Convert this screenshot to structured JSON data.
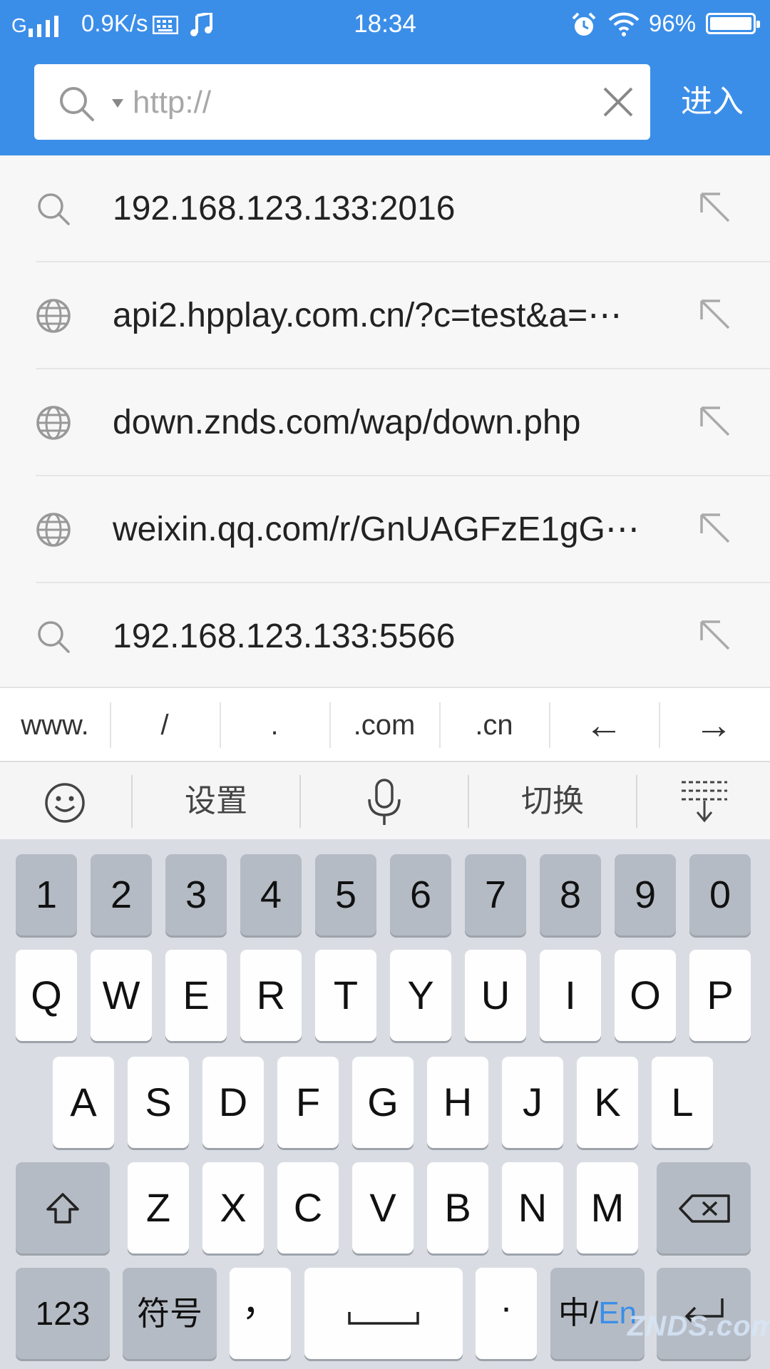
{
  "status_bar": {
    "carrier": "G",
    "net_speed": "0.9K/s",
    "time": "18:34",
    "battery": "96%"
  },
  "address_bar": {
    "value": "",
    "placeholder": "http://",
    "go_label": "进入"
  },
  "suggestions": [
    {
      "type": "search",
      "icon": "search-icon",
      "text": "192.168.123.133:2016"
    },
    {
      "type": "url",
      "icon": "globe-icon",
      "text": "api2.hpplay.com.cn/?c=test&a=⋯"
    },
    {
      "type": "url",
      "icon": "globe-icon",
      "text": "down.znds.com/wap/down.php"
    },
    {
      "type": "url",
      "icon": "globe-icon",
      "text": "weixin.qq.com/r/GnUAGFzE1gG⋯"
    },
    {
      "type": "search",
      "icon": "search-icon",
      "text": "192.168.123.133:5566"
    }
  ],
  "shortcuts": [
    "www.",
    "/",
    ".",
    ".com",
    ".cn",
    "←",
    "→"
  ],
  "keyboard_toolbar": {
    "emoji_icon": "emoji-icon",
    "settings_label": "设置",
    "mic_icon": "microphone-icon",
    "switch_label": "切换",
    "hide_icon": "hide-keyboard-icon"
  },
  "keyboard": {
    "numbers": [
      "1",
      "2",
      "3",
      "4",
      "5",
      "6",
      "7",
      "8",
      "9",
      "0"
    ],
    "row1": [
      "Q",
      "W",
      "E",
      "R",
      "T",
      "Y",
      "U",
      "I",
      "O",
      "P"
    ],
    "row2": [
      "A",
      "S",
      "D",
      "F",
      "G",
      "H",
      "J",
      "K",
      "L"
    ],
    "row3": [
      "Z",
      "X",
      "C",
      "V",
      "B",
      "N",
      "M"
    ],
    "shift_icon": "shift-icon",
    "backspace_icon": "backspace-icon",
    "key_123": "123",
    "key_symbols": "符号",
    "key_comma": "，",
    "space_icon": "space-icon",
    "key_dot": "·",
    "key_lang_zh": "中/",
    "key_lang_en": "En",
    "enter_icon": "enter-icon"
  },
  "watermark": "ZNDS.com",
  "colors": {
    "header_blue": "#3b8ee8",
    "keyboard_bg": "#d9dde3",
    "key_light": "#fefefe",
    "key_dark": "#b5bbc4",
    "accent_en": "#3b8ee8"
  }
}
